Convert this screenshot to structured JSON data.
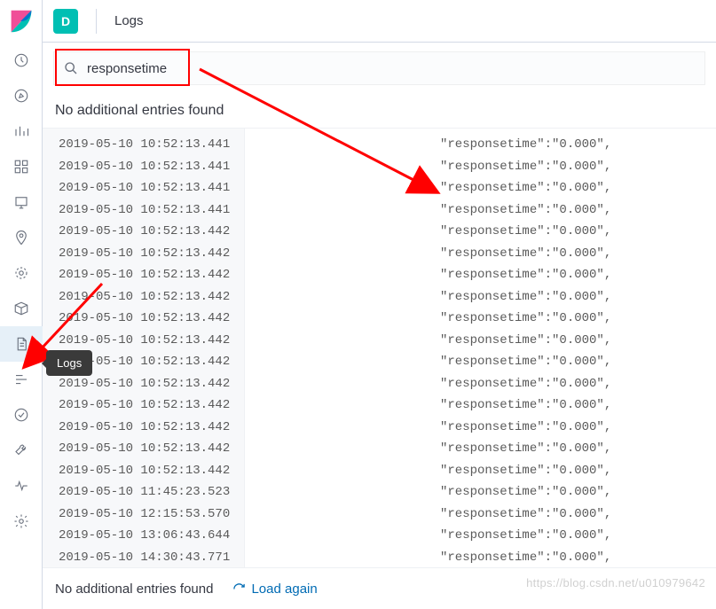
{
  "header": {
    "space_letter": "D",
    "breadcrumb": "Logs"
  },
  "search": {
    "value": "responsetime"
  },
  "tooltip": "Logs",
  "no_entries_top": "No additional entries found",
  "no_entries_bottom": "No additional entries found",
  "load_again": "Load again",
  "watermark": "https://blog.csdn.net/u010979642",
  "logs": [
    {
      "ts": "2019-05-10 10:52:13.441",
      "msg": "\"responsetime\":\"0.000\","
    },
    {
      "ts": "2019-05-10 10:52:13.441",
      "msg": "\"responsetime\":\"0.000\","
    },
    {
      "ts": "2019-05-10 10:52:13.441",
      "msg": "\"responsetime\":\"0.000\","
    },
    {
      "ts": "2019-05-10 10:52:13.441",
      "msg": "\"responsetime\":\"0.000\","
    },
    {
      "ts": "2019-05-10 10:52:13.442",
      "msg": "\"responsetime\":\"0.000\","
    },
    {
      "ts": "2019-05-10 10:52:13.442",
      "msg": "\"responsetime\":\"0.000\","
    },
    {
      "ts": "2019-05-10 10:52:13.442",
      "msg": "\"responsetime\":\"0.000\","
    },
    {
      "ts": "2019-05-10 10:52:13.442",
      "msg": "\"responsetime\":\"0.000\","
    },
    {
      "ts": "2019-05-10 10:52:13.442",
      "msg": "\"responsetime\":\"0.000\","
    },
    {
      "ts": "2019-05-10 10:52:13.442",
      "msg": "\"responsetime\":\"0.000\","
    },
    {
      "ts": "2019-05-10 10:52:13.442",
      "msg": "\"responsetime\":\"0.000\","
    },
    {
      "ts": "2019-05-10 10:52:13.442",
      "msg": "\"responsetime\":\"0.000\","
    },
    {
      "ts": "2019-05-10 10:52:13.442",
      "msg": "\"responsetime\":\"0.000\","
    },
    {
      "ts": "2019-05-10 10:52:13.442",
      "msg": "\"responsetime\":\"0.000\","
    },
    {
      "ts": "2019-05-10 10:52:13.442",
      "msg": "\"responsetime\":\"0.000\","
    },
    {
      "ts": "2019-05-10 10:52:13.442",
      "msg": "\"responsetime\":\"0.000\","
    },
    {
      "ts": "2019-05-10 11:45:23.523",
      "msg": "\"responsetime\":\"0.000\","
    },
    {
      "ts": "2019-05-10 12:15:53.570",
      "msg": "\"responsetime\":\"0.000\","
    },
    {
      "ts": "2019-05-10 13:06:43.644",
      "msg": "\"responsetime\":\"0.000\","
    },
    {
      "ts": "2019-05-10 14:30:43.771",
      "msg": "\"responsetime\":\"0.000\","
    }
  ]
}
